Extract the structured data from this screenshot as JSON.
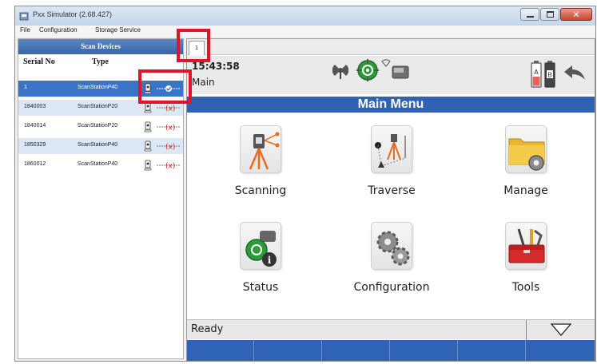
{
  "window": {
    "title": "Pxx Simulator (2.68.427)"
  },
  "menubar": {
    "items": [
      "File",
      "Configuration",
      "Storage Service"
    ]
  },
  "scan_devices": {
    "header": "Scan Devices",
    "columns": [
      "Serial No",
      "Type"
    ],
    "rows": [
      {
        "serial": "1",
        "type": "ScanStationP40",
        "selected": true
      },
      {
        "serial": "1840003",
        "type": "ScanStationP20",
        "selected": false
      },
      {
        "serial": "1840014",
        "type": "ScanStationP20",
        "selected": false
      },
      {
        "serial": "1850329",
        "type": "ScanStationP40",
        "selected": false
      },
      {
        "serial": "1860012",
        "type": "ScanStationP40",
        "selected": false
      }
    ]
  },
  "main": {
    "tab_label": "1",
    "time": "15:43:58",
    "mode": "Main",
    "menu_title": "Main Menu",
    "tiles": [
      "Scanning",
      "Traverse",
      "Manage",
      "Status",
      "Configuration",
      "Tools"
    ],
    "status_text": "Ready"
  },
  "colors": {
    "accent_blue": "#2f62b3",
    "selection_blue": "#3b73c9",
    "highlight_red": "#e0152c"
  }
}
